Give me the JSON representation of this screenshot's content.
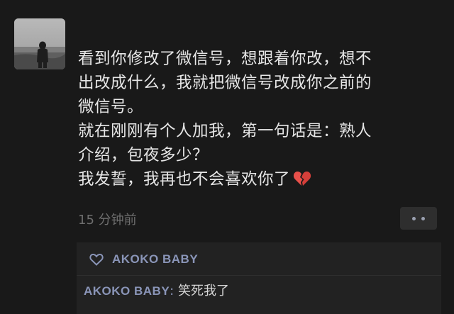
{
  "post": {
    "lines": [
      "看到你修改了微信号，想跟着你改，想不",
      "出改成什么，我就把微信号改成你之前的",
      "微信号。",
      "就在刚刚有个人加我，第一句话是：熟人",
      "介绍，包夜多少？",
      "我发誓，我再也不会喜欢你了"
    ],
    "emoji": "broken-heart-icon",
    "timestamp": "15 分钟前"
  },
  "likes": {
    "icon": "heart-outline-icon",
    "names": "AKOKO BABY"
  },
  "comments": [
    {
      "author": "AKOKO BABY",
      "separator": ": ",
      "text": "笑死我了"
    }
  ],
  "colors": {
    "background": "#191919",
    "text": "#e6e6e6",
    "name_link": "#8a95b8",
    "timestamp": "#6e6e6e",
    "panel": "#222222"
  }
}
